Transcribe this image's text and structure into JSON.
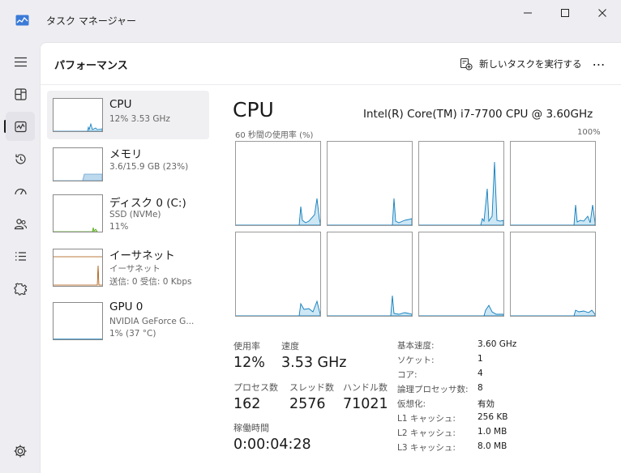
{
  "window": {
    "title": "タスク マネージャー"
  },
  "header": {
    "page_title": "パフォーマンス",
    "run_new_task": "新しいタスクを実行する",
    "more": "⋯"
  },
  "nav": {
    "items": [
      {
        "id": "menu",
        "icon": "hamburger-icon"
      },
      {
        "id": "processes",
        "icon": "processes-icon"
      },
      {
        "id": "performance",
        "icon": "performance-icon",
        "active": true
      },
      {
        "id": "app-history",
        "icon": "history-icon"
      },
      {
        "id": "startup",
        "icon": "startup-icon"
      },
      {
        "id": "users",
        "icon": "users-icon"
      },
      {
        "id": "details",
        "icon": "details-icon"
      },
      {
        "id": "services",
        "icon": "services-icon"
      },
      {
        "id": "settings",
        "icon": "gear-icon"
      }
    ]
  },
  "devices": [
    {
      "name": "CPU",
      "sub1": "12%  3.53 GHz",
      "sub2": "",
      "sub3": "",
      "selected": true,
      "color": "#117dbb"
    },
    {
      "name": "メモリ",
      "sub1": "3.6/15.9 GB (23%)",
      "sub2": "",
      "sub3": "",
      "color": "#8b12ae"
    },
    {
      "name": "ディスク 0 (C:)",
      "sub1": "SSD (NVMe)",
      "sub2": "11%",
      "sub3": "",
      "color": "#4da60c"
    },
    {
      "name": "イーサネット",
      "sub1": "イーサネット",
      "sub2": "送信: 0 受信: 0 Kbps",
      "sub3": "",
      "color": "#a74f01"
    },
    {
      "name": "GPU 0",
      "sub1": "NVIDIA GeForce G...",
      "sub2": "1%  (37 °C)",
      "sub3": "",
      "color": "#117dbb"
    }
  ],
  "detail": {
    "title": "CPU",
    "model": "Intel(R) Core(TM) i7-7700 CPU @ 3.60GHz",
    "axis_label": "60 秒間の使用率 (%)",
    "axis_max": "100%",
    "stats": {
      "usage_label": "使用率",
      "usage_value": "12%",
      "speed_label": "速度",
      "speed_value": "3.53 GHz",
      "processes_label": "プロセス数",
      "processes_value": "162",
      "threads_label": "スレッド数",
      "threads_value": "2576",
      "handles_label": "ハンドル数",
      "handles_value": "71021",
      "uptime_label": "稼働時間",
      "uptime_value": "0:00:04:28"
    },
    "specs": [
      {
        "k": "基本速度:",
        "v": "3.60 GHz"
      },
      {
        "k": "ソケット:",
        "v": "1"
      },
      {
        "k": "コア:",
        "v": "4"
      },
      {
        "k": "論理プロセッサ数:",
        "v": "8"
      },
      {
        "k": "仮想化:",
        "v": "有効"
      },
      {
        "k": "L1 キャッシュ:",
        "v": "256 KB"
      },
      {
        "k": "L2 キャッシュ:",
        "v": "1.0 MB"
      },
      {
        "k": "L3 キャッシュ:",
        "v": "8.0 MB"
      }
    ]
  },
  "colors": {
    "cpu_line": "#117dbb",
    "cpu_fill": "#cde7f5",
    "memory_line": "#8b12ae",
    "ethernet_line": "#a74f01",
    "disk_line": "#4da60c",
    "grid": "#e6eef5"
  }
}
